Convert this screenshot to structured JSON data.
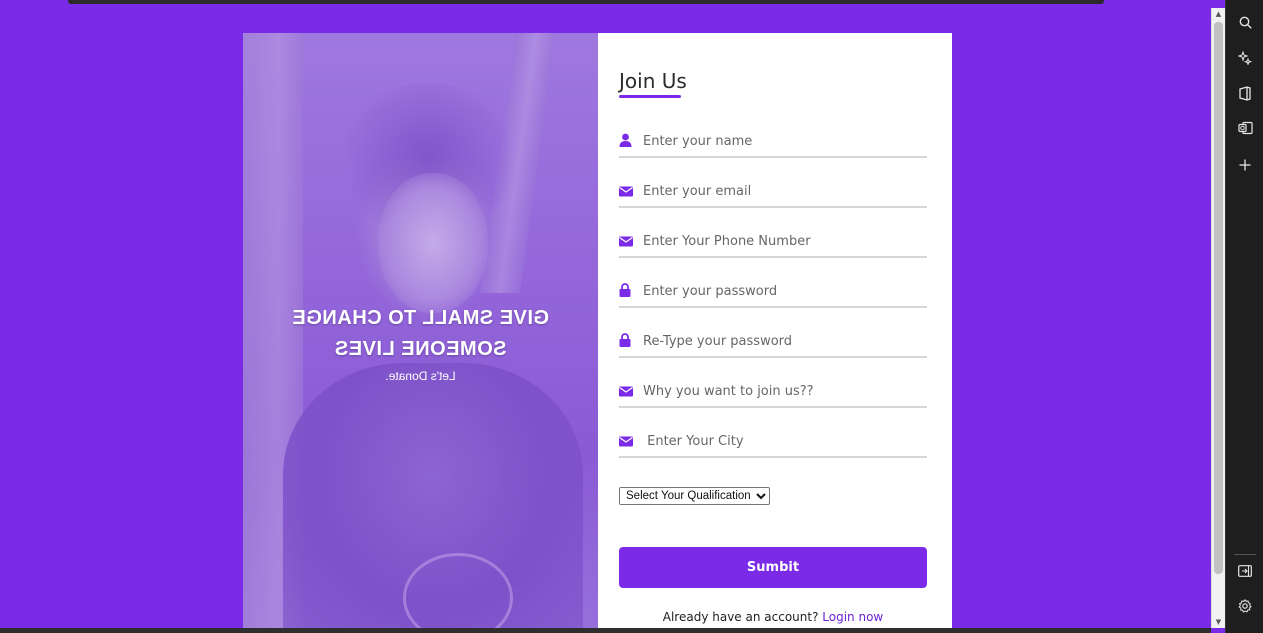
{
  "hero": {
    "headline_line1": "GIVE SMALL TO CHANGE",
    "headline_line2": "SOMEONE LIVES",
    "subline": "Let's Donate."
  },
  "form": {
    "title": "Join Us",
    "fields": [
      {
        "name": "name",
        "icon": "user-icon",
        "placeholder": "Enter your name"
      },
      {
        "name": "email",
        "icon": "envelope-icon",
        "placeholder": "Enter your email"
      },
      {
        "name": "phone",
        "icon": "envelope-icon",
        "placeholder": "Enter Your Phone Number"
      },
      {
        "name": "password",
        "icon": "lock-icon",
        "placeholder": "Enter your password"
      },
      {
        "name": "retype_password",
        "icon": "lock-icon",
        "placeholder": "Re-Type your password"
      },
      {
        "name": "reason",
        "icon": "envelope-icon",
        "placeholder": "Why you want to join us??"
      },
      {
        "name": "city",
        "icon": "envelope-icon",
        "placeholder": " Enter Your City"
      }
    ],
    "qualification_select": "Select Your Qualification",
    "submit_label": "Sumbit",
    "login_prompt": "Already have an account?",
    "login_link": "Login now"
  },
  "edge_sidebar": {
    "icons": [
      "search-icon",
      "copilot-icon",
      "office-icon",
      "outlook-icon",
      "add-icon",
      "split-screen-icon",
      "settings-icon"
    ]
  },
  "colors": {
    "accent": "#7b2be8",
    "page_background": "#7b2be8",
    "card_background": "#ffffff"
  }
}
